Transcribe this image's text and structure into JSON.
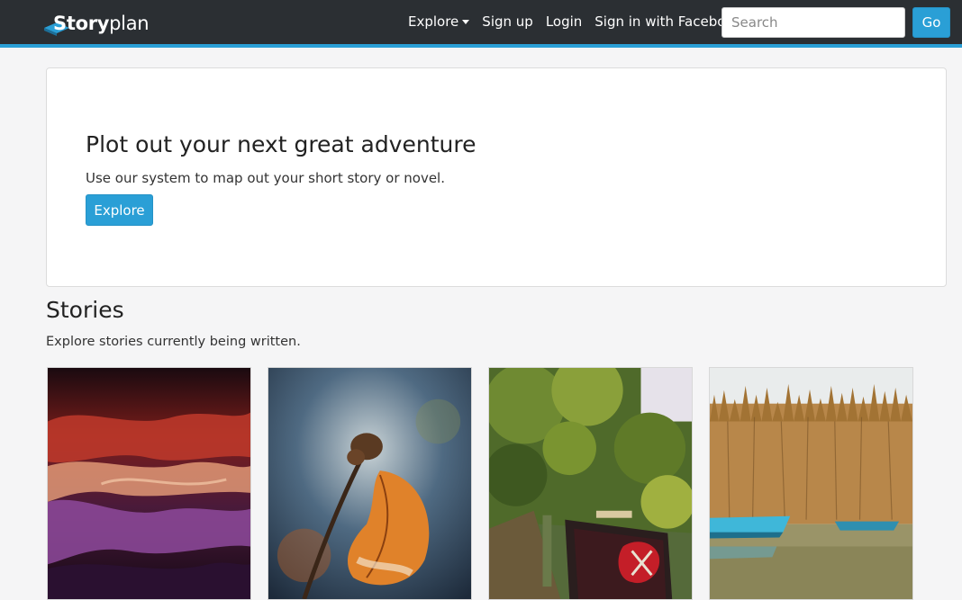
{
  "navbar": {
    "brand_bold": "Story",
    "brand_light": "plan",
    "links": [
      {
        "label": "Explore",
        "dropdown": true
      },
      {
        "label": "Sign up"
      },
      {
        "label": "Login"
      },
      {
        "label": "Sign in with Facebook"
      }
    ],
    "search_placeholder": "Search",
    "go_label": "Go",
    "accent_color": "#2a9fd6",
    "bg_color": "#2b2f33"
  },
  "jumbotron": {
    "title": "Plot out your next great adventure",
    "text": "Use our system to map out your short story or novel.",
    "button_label": "Explore"
  },
  "stories": {
    "title": "Stories",
    "subtitle": "Explore stories currently being written.",
    "cards": [
      {
        "image": "canyon-photo"
      },
      {
        "image": "autumn-leaf-photo"
      },
      {
        "image": "canal-boat-photo"
      },
      {
        "image": "reeds-boats-photo"
      }
    ]
  }
}
